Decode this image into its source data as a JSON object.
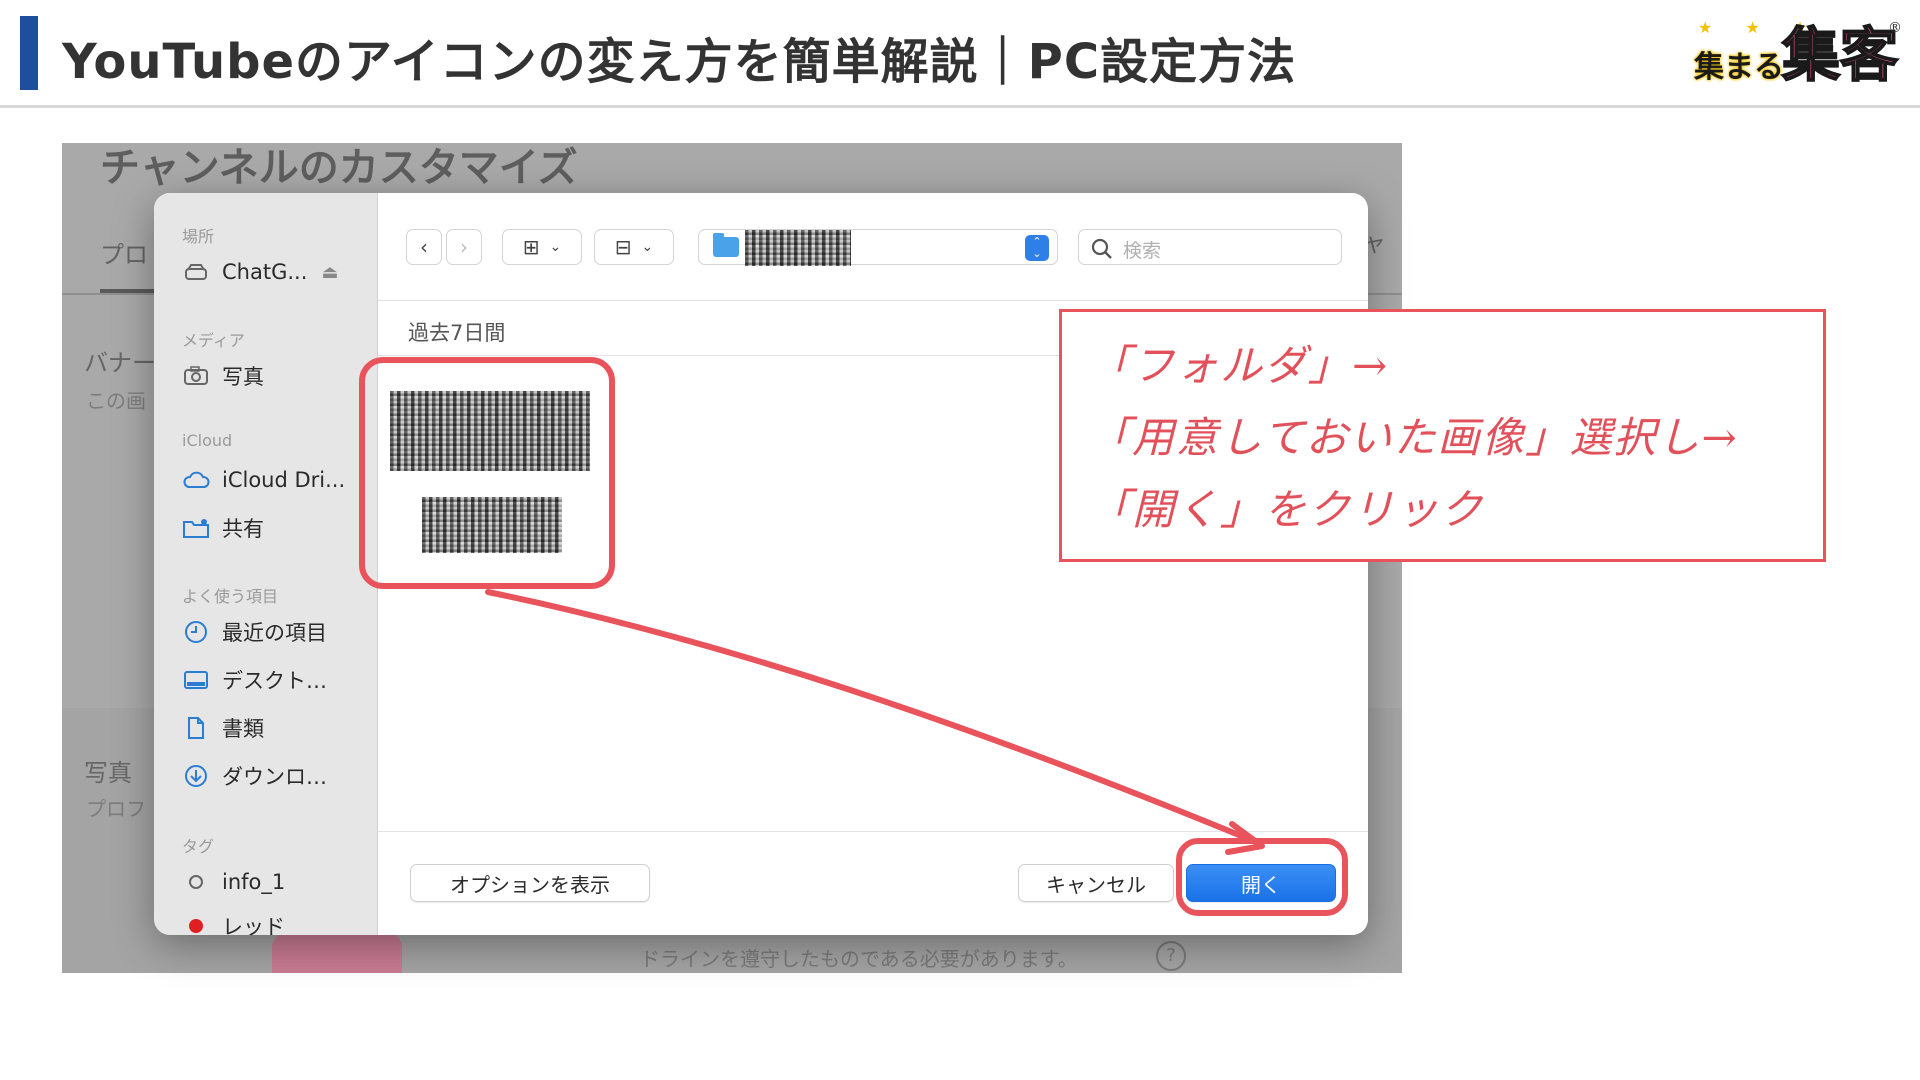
{
  "slide": {
    "title": "YouTubeのアイコンの変え方を簡単解説｜PC設定方法",
    "logo": {
      "stars": "★ ★ ★",
      "small": "集まる",
      "big": "集客",
      "reg": "®"
    }
  },
  "background_page": {
    "title": "チャンネルのカスタマイズ",
    "tab": "プロ",
    "tab_right": "ャ",
    "banner_label": "バナー",
    "banner_sub": "この画",
    "photo_label": "写真",
    "photo_sub": "プロフ",
    "bottom_text": "ドラインを遵守したものである必要があります。",
    "help": "?"
  },
  "dialog": {
    "sidebar": {
      "sections": [
        {
          "title": "場所",
          "items": [
            {
              "label": "ChatG...",
              "icon": "drive-icon",
              "suffix": "⏏"
            }
          ]
        },
        {
          "title": "メディア",
          "items": [
            {
              "label": "写真",
              "icon": "camera-icon"
            }
          ]
        },
        {
          "title": "iCloud",
          "items": [
            {
              "label": "iCloud Dri...",
              "icon": "cloud-icon"
            },
            {
              "label": "共有",
              "icon": "shared-folder-icon"
            }
          ]
        },
        {
          "title": "よく使う項目",
          "items": [
            {
              "label": "最近の項目",
              "icon": "clock-icon"
            },
            {
              "label": "デスクト…",
              "icon": "desktop-icon"
            },
            {
              "label": "書類",
              "icon": "document-icon"
            },
            {
              "label": "ダウンロ…",
              "icon": "download-icon"
            }
          ]
        },
        {
          "title": "タグ",
          "items": [
            {
              "label": "info_1",
              "icon": "tag-circle-icon"
            },
            {
              "label": "レッド",
              "icon": "tag-red-icon"
            }
          ]
        }
      ]
    },
    "toolbar": {
      "back": "‹",
      "forward": "›",
      "view_grid": "⊞",
      "view_group": "⊟",
      "search_placeholder": "検索"
    },
    "section_header": "過去7日間",
    "footer": {
      "options": "オプションを表示",
      "cancel": "キャンセル",
      "open": "開く"
    }
  },
  "callout": {
    "lines": [
      "「フォルダ」→",
      "「用意しておいた画像」選択し→",
      "「開く」をクリック"
    ]
  },
  "colors": {
    "accent_red": "#e9535c",
    "title_bar": "#1f4e9e",
    "open_button": "#1a72e8"
  }
}
